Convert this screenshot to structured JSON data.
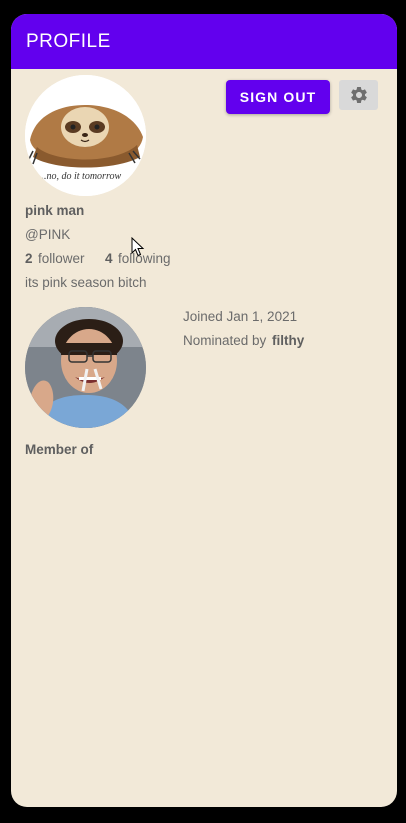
{
  "appbar": {
    "title": "PROFILE"
  },
  "actions": {
    "sign_out_label": "SIGN OUT",
    "settings_icon": "gear-icon"
  },
  "profile": {
    "name": "pink man",
    "handle": "@PINK",
    "followers_count": "2",
    "followers_label": "follower",
    "following_count": "4",
    "following_label": "following",
    "bio": "its pink season bitch",
    "avatar_caption": "...no, do it tomorrow"
  },
  "nomination": {
    "joined": "Joined Jan 1, 2021",
    "nominated_prefix": "Nominated by",
    "nominated_by": "filthy"
  },
  "membership": {
    "label": "Member of"
  },
  "colors": {
    "primary": "#6200ee",
    "background": "#f2e9d8"
  }
}
